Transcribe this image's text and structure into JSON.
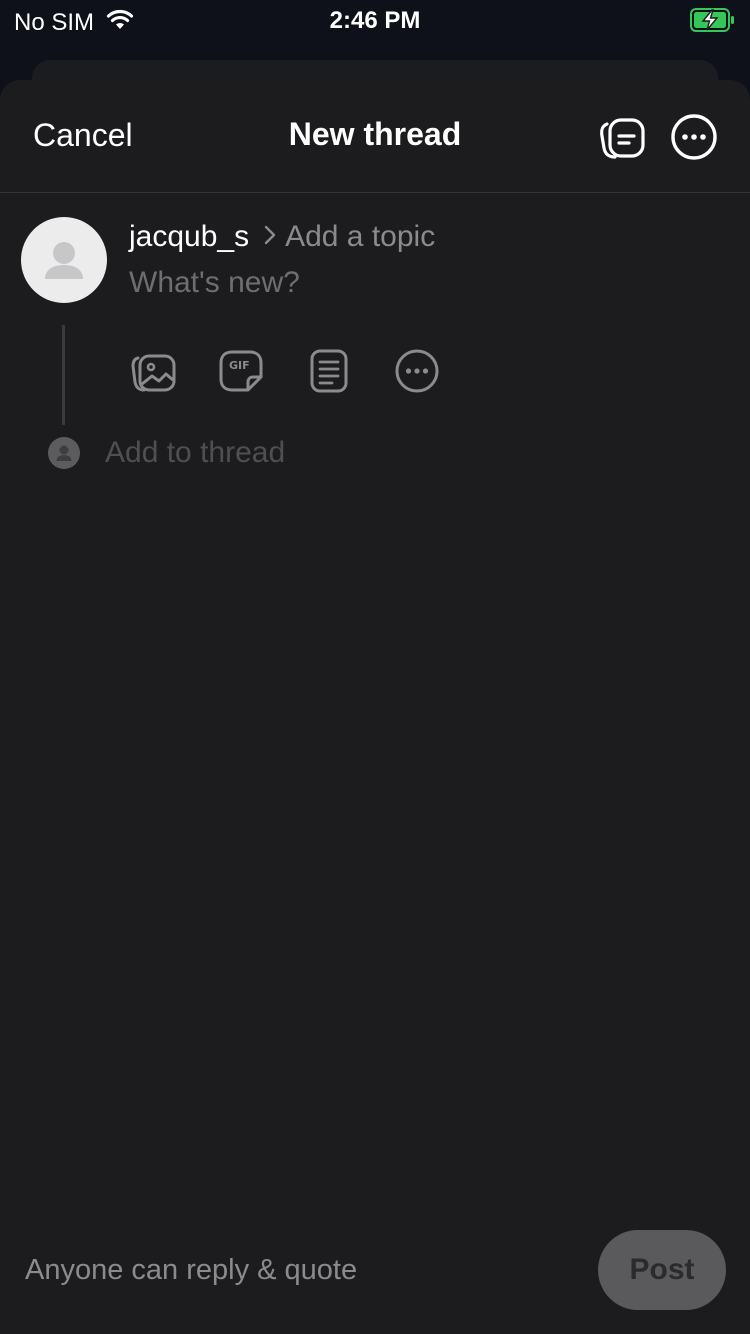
{
  "status_bar": {
    "carrier": "No SIM",
    "time": "2:46 PM",
    "battery_color": "#35c759"
  },
  "header": {
    "cancel_label": "Cancel",
    "title": "New thread",
    "drafts_icon": "drafts-icon",
    "more_icon": "ellipsis-circle-icon"
  },
  "composer": {
    "username": "jacqub_s",
    "topic_placeholder": "Add a topic",
    "text_placeholder": "What's new?",
    "attachments": [
      {
        "name": "photo-gallery-icon"
      },
      {
        "name": "gif-icon"
      },
      {
        "name": "document-icon"
      },
      {
        "name": "more-options-icon"
      }
    ],
    "add_to_thread_placeholder": "Add to thread"
  },
  "footer": {
    "reply_settings": "Anyone can reply & quote",
    "post_label": "Post"
  },
  "colors": {
    "background": "#0e111a",
    "sheet": "#1c1c1e",
    "muted_text": "#8b8b8f",
    "post_button_bg": "#5a5a5c"
  }
}
